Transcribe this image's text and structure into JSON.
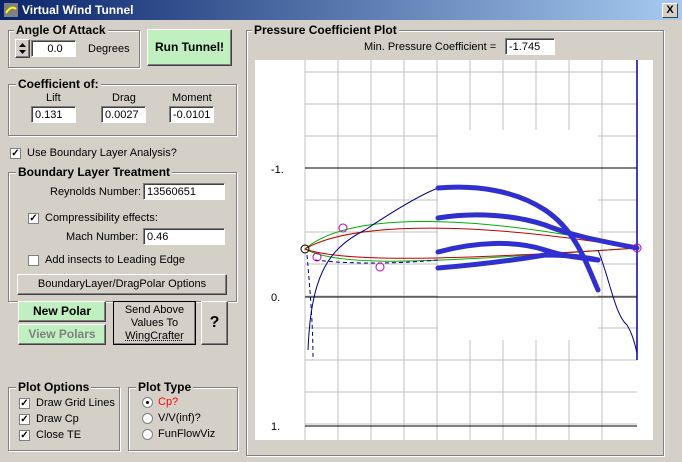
{
  "window": {
    "title": "Virtual Wind Tunnel",
    "close_glyph": "X"
  },
  "angle": {
    "label": "Angle Of Attack",
    "value": "0.0",
    "units": "Degrees"
  },
  "run_button": "Run Tunnel!",
  "coeff": {
    "label": "Coefficient of:",
    "lift_label": "Lift",
    "lift": "0.131",
    "drag_label": "Drag",
    "drag": "0.0027",
    "moment_label": "Moment",
    "moment": "-0.0101"
  },
  "use_bl": {
    "label": "Use Boundary Layer Analysis?",
    "checked": true
  },
  "bl": {
    "label": "Boundary Layer Treatment",
    "reynolds_label": "Reynolds Number:",
    "reynolds": "13560651",
    "compress_label": "Compressibility effects:",
    "compress_checked": true,
    "mach_label": "Mach Number:",
    "mach": "0.46",
    "insects_label": "Add insects to Leading Edge",
    "insects_checked": false,
    "options_button": "BoundaryLayer/DragPolar Options"
  },
  "buttons": {
    "new_polar": "New Polar",
    "view_polars": "View Polars",
    "send_line1": "Send Above",
    "send_line2": "Values To",
    "send_line3": "WingCrafter",
    "help": "?"
  },
  "plot_options": {
    "label": "Plot Options",
    "items": [
      {
        "label": "Draw Grid Lines",
        "checked": true
      },
      {
        "label": "Draw Cp",
        "checked": true
      },
      {
        "label": "Close TE",
        "checked": true
      }
    ]
  },
  "plot_type": {
    "label": "Plot Type",
    "items": [
      {
        "label": "Cp?",
        "selected": true,
        "color": "#ff0000"
      },
      {
        "label": "V/V(inf)?",
        "selected": false,
        "color": "#000000"
      },
      {
        "label": "FunFlowViz",
        "selected": false,
        "color": "#000000"
      }
    ]
  },
  "plot": {
    "label": "Pressure Coefficient Plot",
    "min_cp_label": "Min. Pressure Coefficient =",
    "min_cp": "-1.745",
    "y_ticks": [
      "-1.",
      "0.",
      "1."
    ]
  },
  "chart_data": {
    "type": "line",
    "title": "Pressure Coefficient Plot",
    "xlabel": "",
    "ylabel": "",
    "ylim": [
      -2.0,
      1.0
    ],
    "y_inverted": true,
    "y_ticks": [
      -1,
      0,
      1
    ],
    "grid": true,
    "series": [
      {
        "values_x": [
          0.0,
          0.01,
          0.03,
          0.06,
          0.1,
          0.2,
          0.3,
          0.4,
          0.5,
          0.6,
          0.7,
          0.8,
          0.9,
          0.95,
          1.0
        ],
        "values_y": [
          0.9,
          0.2,
          -0.3,
          -0.5,
          -0.6,
          -0.7,
          -0.8,
          -0.95,
          -0.85,
          -0.75,
          -0.6,
          -0.4,
          -0.2,
          0.1,
          0.3
        ]
      },
      {
        "values_x": [
          0.0,
          0.05,
          0.1,
          0.2,
          0.3,
          0.4,
          0.5,
          0.6,
          0.7,
          0.8,
          0.9,
          0.95,
          1.0
        ],
        "values_y": [
          0.9,
          0.4,
          0.1,
          -0.1,
          -0.2,
          -0.25,
          -0.3,
          -0.3,
          -0.25,
          -0.15,
          0.0,
          0.15,
          0.3
        ]
      }
    ]
  }
}
